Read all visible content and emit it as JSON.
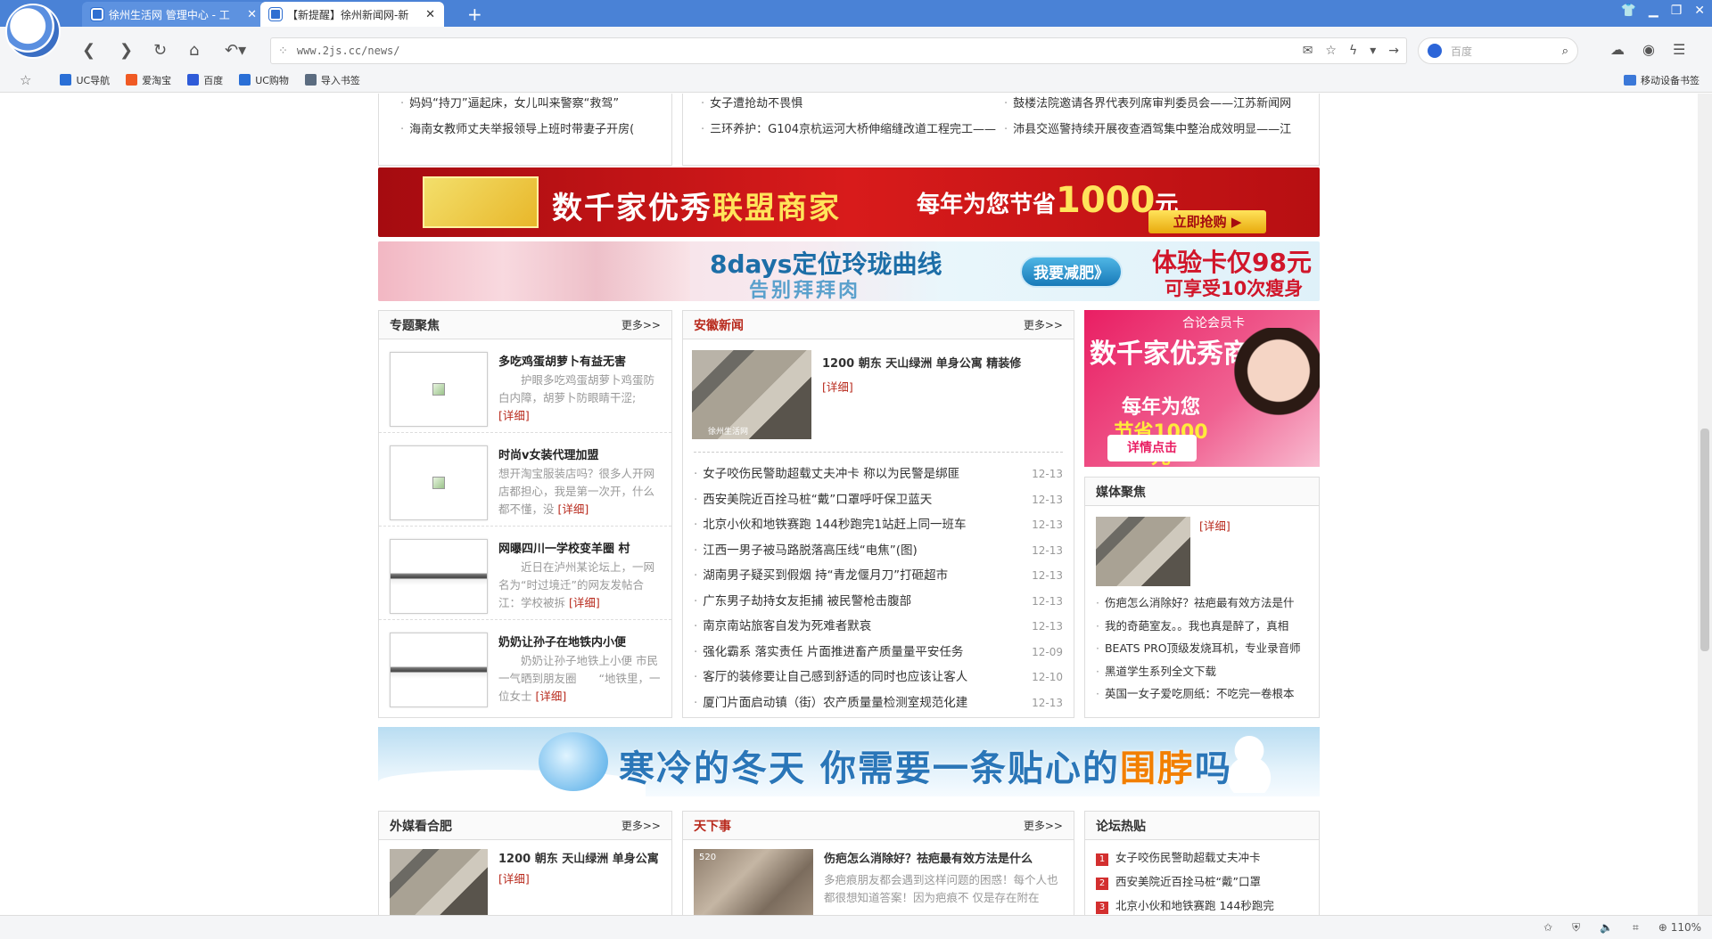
{
  "browser": {
    "tabs": [
      {
        "title": "徐州生活网 管理中心 - 工",
        "active": false
      },
      {
        "title": "【新提醒】徐州新闻网-新",
        "active": true
      }
    ],
    "url": "www.2js.cc/news/",
    "search_placeholder": "百度",
    "bookmarks": [
      "UC导航",
      "爱淘宝",
      "百度",
      "UC购物",
      "导入书签"
    ],
    "bookmark_right": "移动设备书签",
    "zoom": "110%"
  },
  "top_lists": {
    "left": [
      "妈妈“持刀”逼起床，女儿叫来警察“救驾”",
      "海南女教师丈夫举报领导上班时带妻子开房("
    ],
    "mid": [
      "女子遭抢劫不畏惧",
      "三环养护：G104京杭运河大桥伸缩缝改道工程完工——"
    ],
    "right": [
      "鼓楼法院邀请各界代表列席审判委员会——江苏新闻网",
      "沛县交巡警持续开展夜查酒驾集中整治成效明显——江"
    ]
  },
  "banner1": {
    "text1a": "数千家优秀",
    "text1b": "联盟商家",
    "text2a": "每年为您节省",
    "text2b": "1000",
    "text2c": "元",
    "button": "立即抢购 ▶"
  },
  "banner2": {
    "text1": "8days定位玲珑曲线",
    "text2": "告别拜拜肉",
    "button": "我要减肥》",
    "text3": "体验卡仅98元",
    "text4": "可享受10次瘦身"
  },
  "zhuanti": {
    "title": "专题聚焦",
    "more": "更多>>",
    "items": [
      {
        "title": "多吃鸡蛋胡萝卜有益无害",
        "desc": "　　护眼多吃鸡蛋胡萝卜鸡蛋防白内障，胡萝卜防眼睛干涩;",
        "detail": "[详细]"
      },
      {
        "title": "时尚v女装代理加盟",
        "desc": "想开淘宝服装店吗？很多人开网店都担心，我是第一次开，什么都不懂，没",
        "detail": "[详细]"
      },
      {
        "title": "网曝四川一学校变羊圈 村",
        "desc": "　　近日在泸州某论坛上，一网名为“时过境迁”的网友发帖合江：学校被拆",
        "detail": "[详细]"
      },
      {
        "title": "奶奶让孙子在地铁内小便",
        "desc": "　　奶奶让孙子地铁上小便 市民一气晒到朋友圈　　“地铁里，一位女士",
        "detail": "[详细]"
      }
    ]
  },
  "anhui": {
    "title": "安徽新闻",
    "more": "更多>>",
    "top_title": "1200 朝东 天山绿洲 单身公寓 精装修",
    "top_detail": "[详细]",
    "watermark": "徐州生活网",
    "items": [
      {
        "t": "女子咬伤民警助超载丈夫冲卡 称以为民警是绑匪",
        "d": "12-13"
      },
      {
        "t": "西安美院近百拴马桩“戴”口罩呼吁保卫蓝天",
        "d": "12-13"
      },
      {
        "t": "北京小伙和地铁赛跑 144秒跑完1站赶上同一班车",
        "d": "12-13"
      },
      {
        "t": "江西一男子被马路脱落高压线“电焦”(图)",
        "d": "12-13"
      },
      {
        "t": "湖南男子疑买到假烟 持“青龙偃月刀”打砸超市",
        "d": "12-13"
      },
      {
        "t": "广东男子劫持女友拒捕 被民警枪击腹部",
        "d": "12-13"
      },
      {
        "t": "南京南站旅客自发为死难者默哀",
        "d": "12-13"
      },
      {
        "t": "强化霸系 落实责任 片面推进畜产质量量平安任务",
        "d": "12-09"
      },
      {
        "t": "客厅的装修要让自己感到舒适的同时也应该让客人",
        "d": "12-10"
      },
      {
        "t": "厦门片面启动镇（街）农产质量量检测室规范化建",
        "d": "12-13"
      }
    ]
  },
  "ad3": {
    "a": "合论会员卡",
    "b": "数千家优秀商家",
    "c1": "每年为您",
    "c2": "节省1000元",
    "button": "详情点击"
  },
  "meiti": {
    "title": "媒体聚焦",
    "detail": "[详细]",
    "items": [
      "伤疤怎么消除好？祛疤最有效方法是什",
      "我的奇葩室友。。我也真是醉了，真相",
      "BEATS PRO顶级发烧耳机，专业录音师",
      "黑道学生系列全文下载",
      "英国一女子爱吃厕纸：不吃完一卷根本"
    ]
  },
  "banner4": {
    "text_a": "寒冷的冬天 你需要一条贴心的",
    "text_b": "围脖",
    "text_c": "吗"
  },
  "waimei": {
    "title": "外媒看合肥",
    "more": "更多>>",
    "item_title": "1200 朝东 天山绿洲 单身公寓",
    "detail": "[详细]"
  },
  "tianxia": {
    "title": "天下事",
    "more": "更多>>",
    "item_title": "伤疤怎么消除好？祛疤最有效方法是什么",
    "desc": "多疤痕朋友都会遇到这样问题的困惑！每个人也都很想知道答案！因为疤痕不 仅是存在附在",
    "thumb_tag": "520"
  },
  "luntan": {
    "title": "论坛热贴",
    "items": [
      "女子咬伤民警助超载丈夫冲卡",
      "西安美院近百拴马桩“戴”口罩",
      "北京小伙和地铁赛跑 144秒跑完"
    ]
  }
}
